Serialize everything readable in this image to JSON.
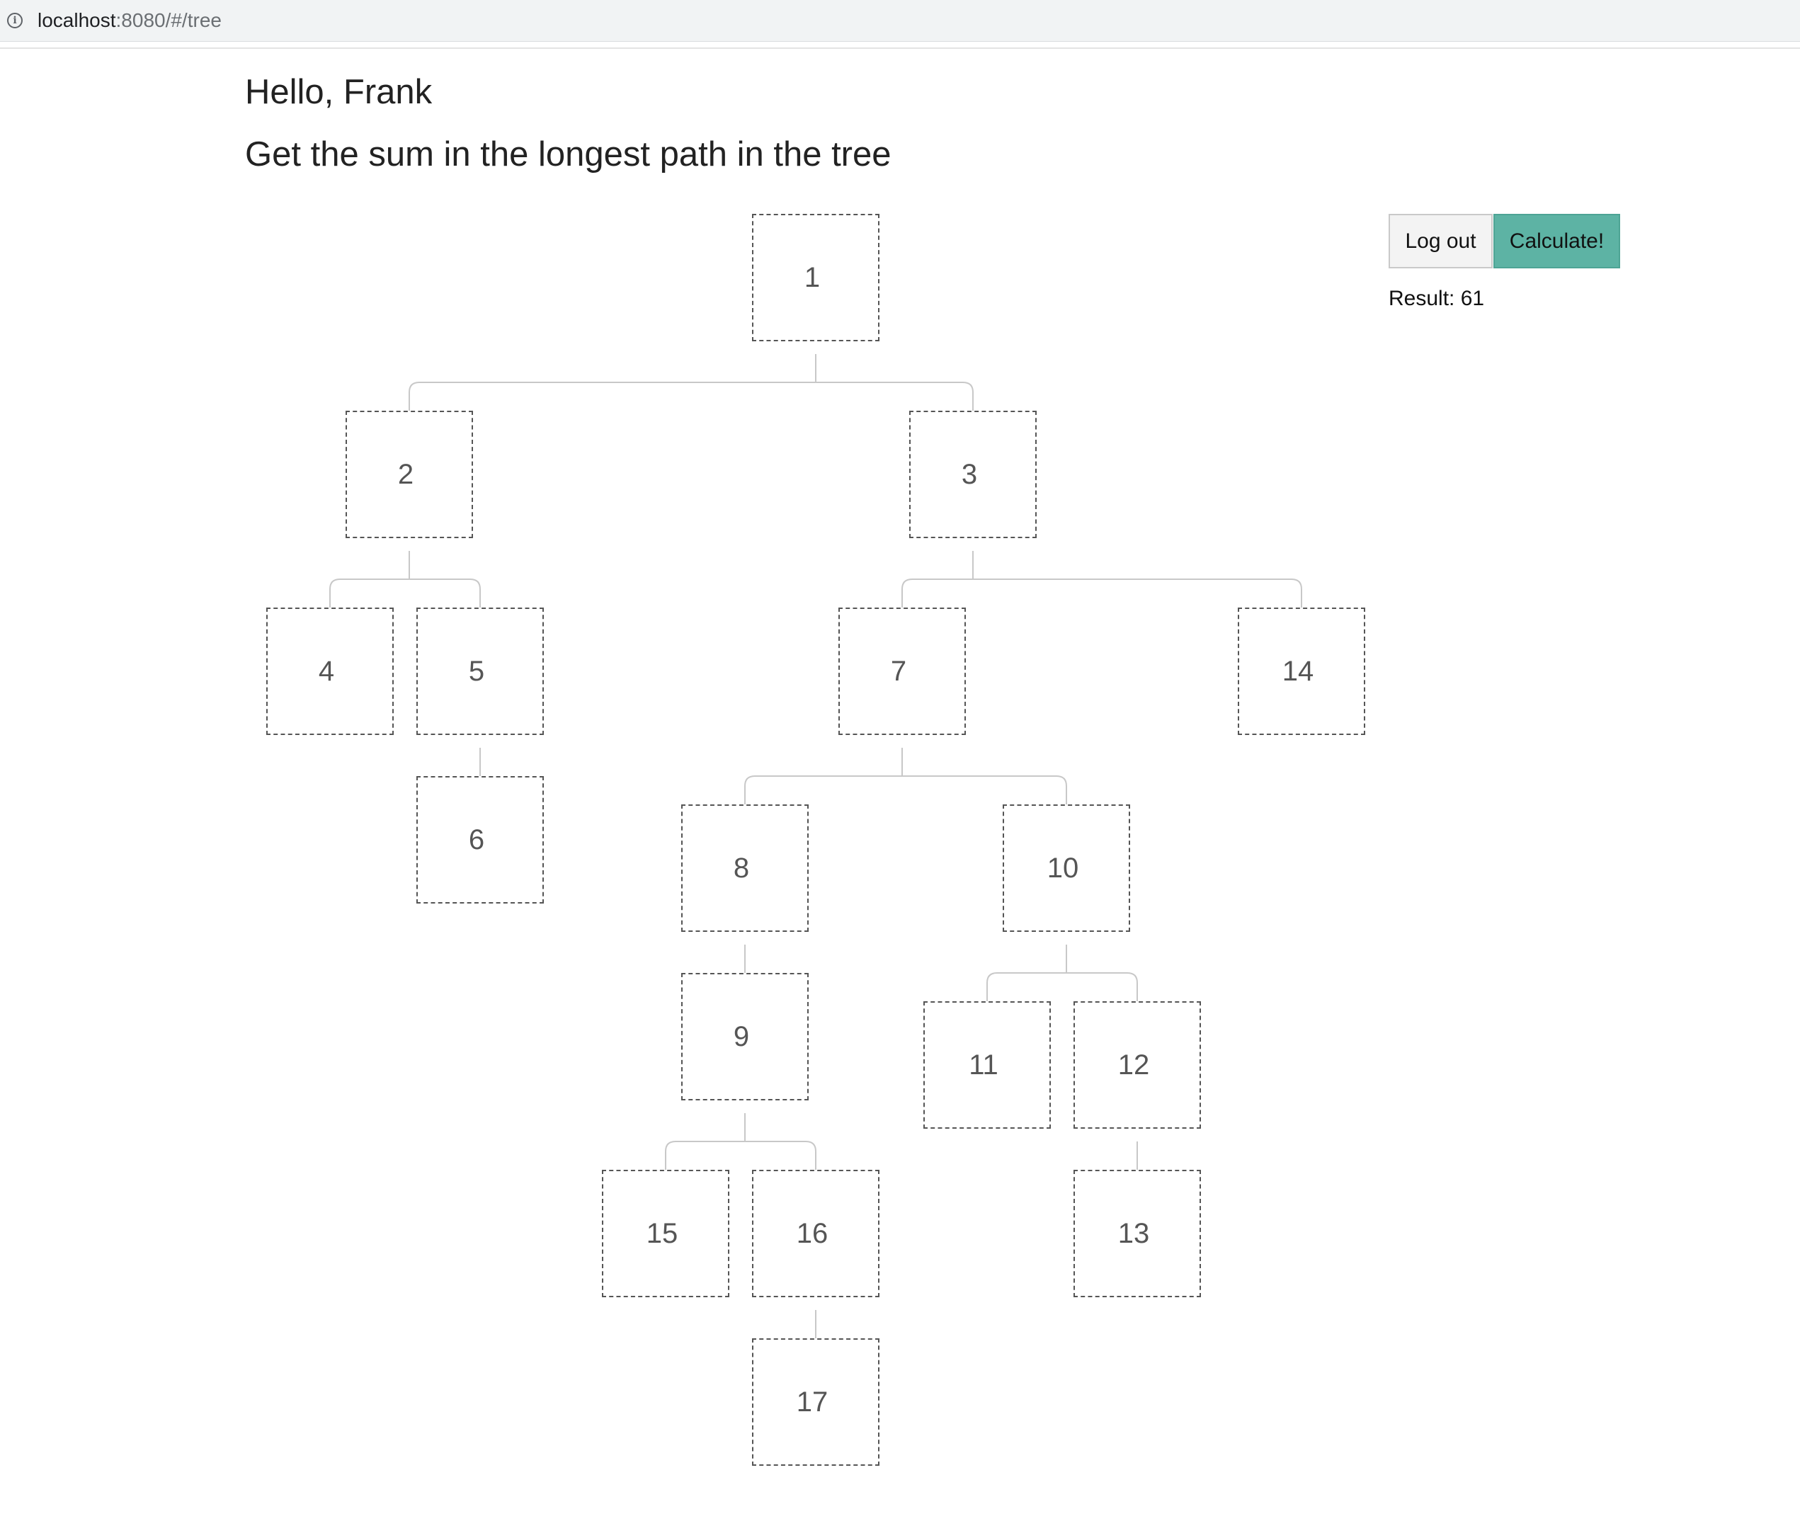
{
  "browser": {
    "url_host": "localhost",
    "url_path": ":8080/#/tree"
  },
  "page": {
    "greeting": "Hello, Frank",
    "task_title": "Get the sum in the longest path in the tree"
  },
  "actions": {
    "logout_label": "Log out",
    "calculate_label": "Calculate!"
  },
  "result": {
    "label": "Result:",
    "value": "61"
  },
  "tree": {
    "nodes": [
      {
        "id": "1",
        "label": "1"
      },
      {
        "id": "2",
        "label": "2"
      },
      {
        "id": "3",
        "label": "3"
      },
      {
        "id": "4",
        "label": "4"
      },
      {
        "id": "5",
        "label": "5"
      },
      {
        "id": "6",
        "label": "6"
      },
      {
        "id": "7",
        "label": "7"
      },
      {
        "id": "14",
        "label": "14"
      },
      {
        "id": "8",
        "label": "8"
      },
      {
        "id": "10",
        "label": "10"
      },
      {
        "id": "9",
        "label": "9"
      },
      {
        "id": "11",
        "label": "11"
      },
      {
        "id": "12",
        "label": "12"
      },
      {
        "id": "15",
        "label": "15"
      },
      {
        "id": "16",
        "label": "16"
      },
      {
        "id": "13",
        "label": "13"
      },
      {
        "id": "17",
        "label": "17"
      }
    ],
    "edges": [
      [
        "1",
        "2"
      ],
      [
        "1",
        "3"
      ],
      [
        "2",
        "4"
      ],
      [
        "2",
        "5"
      ],
      [
        "5",
        "6"
      ],
      [
        "3",
        "7"
      ],
      [
        "3",
        "14"
      ],
      [
        "7",
        "8"
      ],
      [
        "7",
        "10"
      ],
      [
        "8",
        "9"
      ],
      [
        "9",
        "15"
      ],
      [
        "9",
        "16"
      ],
      [
        "16",
        "17"
      ],
      [
        "10",
        "11"
      ],
      [
        "10",
        "12"
      ],
      [
        "12",
        "13"
      ]
    ]
  }
}
